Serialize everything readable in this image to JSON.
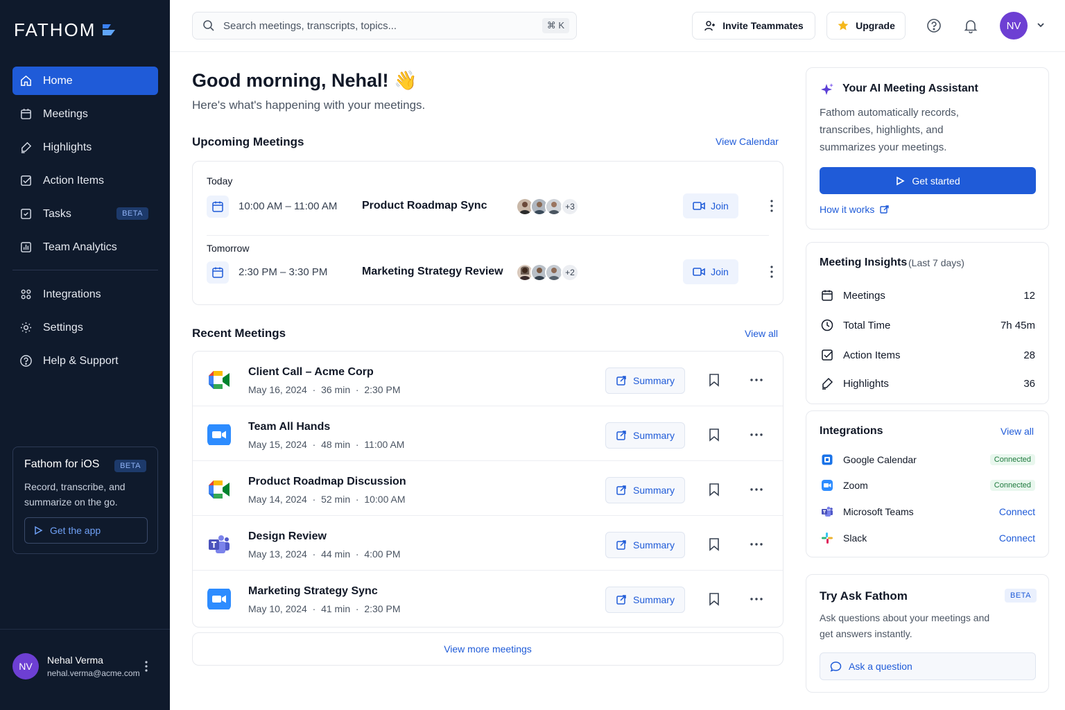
{
  "brand": {
    "name": "FATHOM"
  },
  "sidebar": {
    "items": [
      {
        "label": "Home",
        "icon": "home-icon"
      },
      {
        "label": "Meetings",
        "icon": "calendar-icon"
      },
      {
        "label": "Highlights",
        "icon": "highlighter-icon"
      },
      {
        "label": "Action Items",
        "icon": "checkbox-icon"
      },
      {
        "label": "Tasks",
        "icon": "task-icon",
        "badge": "BETA"
      },
      {
        "label": "Team Analytics",
        "icon": "analytics-icon"
      },
      {
        "label": "Integrations",
        "icon": "grid-icon"
      },
      {
        "label": "Settings",
        "icon": "gear-icon"
      },
      {
        "label": "Help & Support",
        "icon": "help-icon"
      }
    ],
    "ios_card": {
      "title": "Fathom for iOS",
      "badge": "BETA",
      "description": "Record, transcribe, and summarize on the go.",
      "button": "Get the app"
    },
    "user": {
      "initials": "NV",
      "name": "Nehal Verma",
      "email": "nehal.verma@acme.com"
    }
  },
  "topbar": {
    "search_placeholder": "Search meetings, transcripts, topics...",
    "shortcut": "⌘ K",
    "invite_label": "Invite Teammates",
    "upgrade_label": "Upgrade",
    "avatar_initials": "NV"
  },
  "main": {
    "greeting": "Good morning, Nehal! 👋",
    "subtitle": "Here's what's happening with your meetings.",
    "upcoming": {
      "title": "Upcoming Meetings",
      "link": "View Calendar",
      "groups": [
        {
          "day": "Today",
          "time": "10:00 AM – 11:00 AM",
          "title": "Product Roadmap Sync",
          "extra": "+3",
          "join": "Join"
        },
        {
          "day": "Tomorrow",
          "time": "2:30 PM – 3:30 PM",
          "title": "Marketing Strategy Review",
          "extra": "+2",
          "join": "Join"
        }
      ]
    },
    "recent": {
      "title": "Recent Meetings",
      "link": "View all",
      "summary_label": "Summary",
      "rows": [
        {
          "app": "google-meet",
          "title": "Client Call – Acme Corp",
          "date": "May 16, 2024",
          "duration": "36 min",
          "time": "2:30 PM"
        },
        {
          "app": "zoom",
          "title": "Team All Hands",
          "date": "May 15, 2024",
          "duration": "48 min",
          "time": "11:00 AM"
        },
        {
          "app": "google-meet",
          "title": "Product Roadmap Discussion",
          "date": "May 14, 2024",
          "duration": "52 min",
          "time": "10:00 AM"
        },
        {
          "app": "microsoft-teams",
          "title": "Design Review",
          "date": "May 13, 2024",
          "duration": "44 min",
          "time": "4:00 PM"
        },
        {
          "app": "zoom",
          "title": "Marketing Strategy Sync",
          "date": "May 10, 2024",
          "duration": "41 min",
          "time": "2:30 PM"
        }
      ],
      "more_link": "View more meetings"
    }
  },
  "right": {
    "assistant": {
      "title": "Your AI Meeting Assistant",
      "text": "Fathom automatically records, transcribes, highlights, and summarizes your meetings.",
      "button": "Get started",
      "link": "How it works"
    },
    "insights": {
      "title": "Meeting Insights",
      "period": "(Last 7 days)",
      "rows": [
        {
          "label": "Meetings",
          "value": "12",
          "icon": "calendar-icon"
        },
        {
          "label": "Total Time",
          "value": "7h 45m",
          "icon": "clock-icon"
        },
        {
          "label": "Action Items",
          "value": "28",
          "icon": "checkbox-icon"
        },
        {
          "label": "Highlights",
          "value": "36",
          "icon": "highlighter-icon"
        }
      ]
    },
    "integrations": {
      "title": "Integrations",
      "link": "View all",
      "rows": [
        {
          "name": "Google Calendar",
          "status": "Connected",
          "connected": true
        },
        {
          "name": "Zoom",
          "status": "Connected",
          "connected": true
        },
        {
          "name": "Microsoft Teams",
          "status": "Connect",
          "connected": false
        },
        {
          "name": "Slack",
          "status": "Connect",
          "connected": false
        }
      ]
    },
    "ask": {
      "title": "Try Ask Fathom",
      "badge": "BETA",
      "text": "Ask questions about your meetings and get answers instantly.",
      "button": "Ask a question"
    }
  },
  "colors": {
    "accent": "#1f5bd8",
    "sidebar": "#0f1a2c",
    "avatar": "#6d3fd3"
  }
}
